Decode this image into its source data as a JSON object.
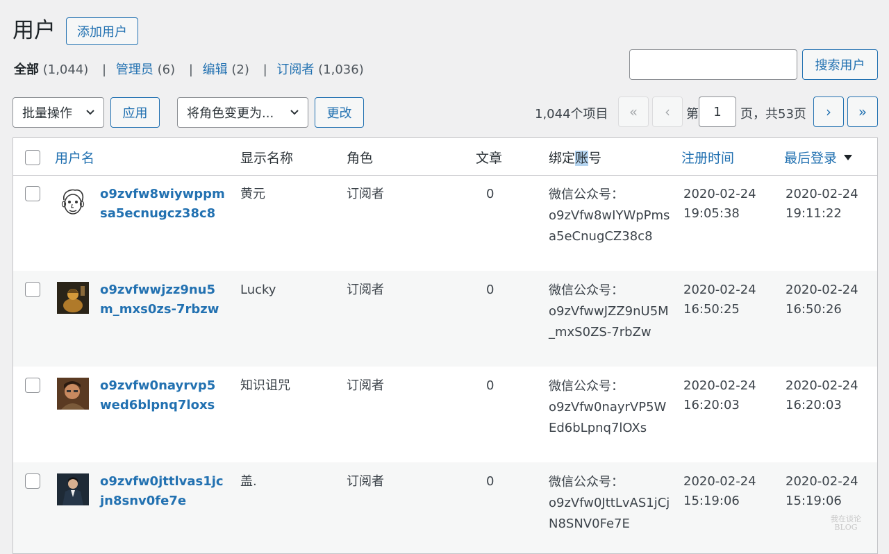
{
  "page": {
    "title": "用户",
    "add_button": "添加用户"
  },
  "filters": [
    {
      "label": "全部",
      "count": "(1,044)",
      "current": true
    },
    {
      "label": "管理员",
      "count": "(6)"
    },
    {
      "label": "编辑",
      "count": "(2)"
    },
    {
      "label": "订阅者",
      "count": "(1,036)"
    }
  ],
  "search": {
    "button": "搜索用户",
    "value": ""
  },
  "toolbar": {
    "bulk_select": "批量操作",
    "apply_button": "应用",
    "role_select": "将角色变更为...",
    "change_button": "更改"
  },
  "pagination": {
    "items_count": "1,044个项目",
    "first": "«",
    "prev": "‹",
    "next": "›",
    "last": "»",
    "label_before": "第",
    "current_page": "1",
    "label_after": "页，共53页"
  },
  "table": {
    "headers": {
      "username": "用户名",
      "display_name": "显示名称",
      "role": "角色",
      "posts": "文章",
      "bound_account_a": "绑定",
      "bound_account_b": "账",
      "bound_account_c": "号",
      "registered": "注册时间",
      "last_login": "最后登录"
    },
    "rows": [
      {
        "username": "o9zvfw8wiywppmsa5ecnugcz38c8",
        "display_name": "黄元",
        "role": "订阅者",
        "posts": "0",
        "account_label": "微信公众号：",
        "account_id": "o9zVfw8wIYWpPmsa5eCnugCZ38c8",
        "registered_date": "2020-02-24",
        "registered_time": "19:05:38",
        "login_date": "2020-02-24",
        "login_time": "19:11:22",
        "avatar": "cartoon-face-avatar"
      },
      {
        "username": "o9zvfwwjzz9nu5m_mxs0zs-7rbzw",
        "display_name": "Lucky",
        "role": "订阅者",
        "posts": "0",
        "account_label": "微信公众号：",
        "account_id": "o9zVfwwJZZ9nU5M_mxS0ZS-7rbZw",
        "registered_date": "2020-02-24",
        "registered_time": "16:50:25",
        "login_date": "2020-02-24",
        "login_time": "16:50:26",
        "avatar": "buddha-photo-avatar"
      },
      {
        "username": "o9zvfw0nayrvp5wed6blpnq7loxs",
        "display_name": "知识诅咒",
        "role": "订阅者",
        "posts": "0",
        "account_label": "微信公众号：",
        "account_id": "o9zVfw0nayrVP5WEd6bLpnq7lOXs",
        "registered_date": "2020-02-24",
        "registered_time": "16:20:03",
        "login_date": "2020-02-24",
        "login_time": "16:20:03",
        "avatar": "man-photo-avatar"
      },
      {
        "username": "o9zvfw0jttlvas1jcjn8snv0fe7e",
        "display_name": "盖.",
        "role": "订阅者",
        "posts": "0",
        "account_label": "微信公众号：",
        "account_id": "o9zVfw0JttLvAS1jCjN8SNV0Fe7E",
        "registered_date": "2020-02-24",
        "registered_time": "15:19:06",
        "login_date": "2020-02-24",
        "login_time": "15:19:06",
        "avatar": "suit-man-photo-avatar"
      }
    ]
  },
  "watermark": {
    "line1": "我在谈论",
    "line2": "BLOG"
  }
}
